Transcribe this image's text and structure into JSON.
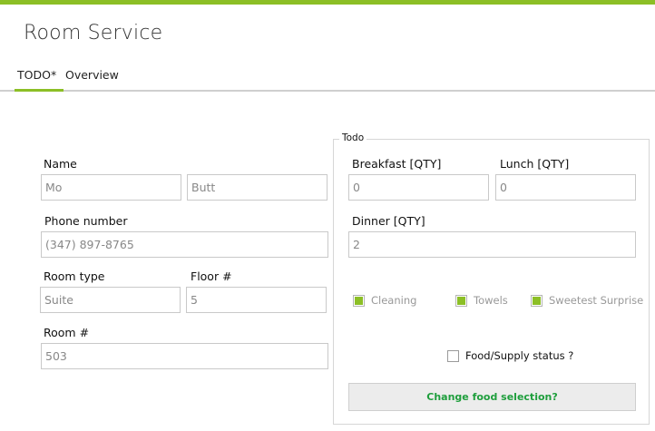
{
  "app": {
    "title": "Room Service"
  },
  "tabs": [
    {
      "label": "TODO*",
      "active": true
    },
    {
      "label": "Overview",
      "active": false
    }
  ],
  "form": {
    "name_label": "Name",
    "first_name": "Mo",
    "last_name": "Butt",
    "phone_label": "Phone number",
    "phone": "(347) 897-8765",
    "room_type_label": "Room type",
    "room_type": "Suite",
    "floor_label": "Floor #",
    "floor": "5",
    "room_label": "Room #",
    "room": "503"
  },
  "todo": {
    "group_title": "Todo",
    "breakfast_label": "Breakfast [QTY]",
    "breakfast": "0",
    "lunch_label": "Lunch [QTY]",
    "lunch": "0",
    "dinner_label": "Dinner [QTY]",
    "dinner": "2",
    "checkboxes": [
      {
        "label": "Cleaning",
        "checked": true,
        "enabled": false
      },
      {
        "label": "Towels",
        "checked": true,
        "enabled": false
      },
      {
        "label": "Sweetest Surprise",
        "checked": true,
        "enabled": false
      }
    ],
    "status_checkbox": {
      "label": "Food/Supply status ?",
      "checked": false
    },
    "action_button": "Change food selection?"
  },
  "colors": {
    "accent": "#8cbf26",
    "button_text": "#1e9e3c",
    "field_text": "#888888"
  }
}
